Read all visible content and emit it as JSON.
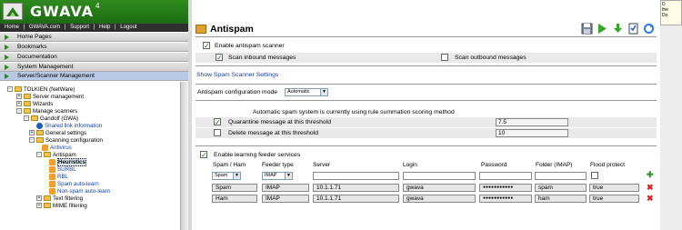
{
  "app": {
    "brand": "GWAVA",
    "version": "4"
  },
  "topbar": {
    "links": [
      "Home",
      "|",
      "GWAVA.com",
      "|",
      "Support",
      "|",
      "Help",
      "|",
      "Logout"
    ]
  },
  "nav": [
    "Home Pages",
    "Bookmarks",
    "Documentation",
    "System Management",
    "Server/Scanner Management"
  ],
  "tree": {
    "server": "TOLKIEN (NetWare)",
    "server_mgmt": "Server management",
    "wizards": "Wizards",
    "manage_scanners": "Manage scanners",
    "scanner": "Gandolf (GWA)",
    "shared_link": "Shared link information",
    "general_settings": "General settings",
    "scanning_config": "Scanning configuration",
    "antivirus": "Antivirus",
    "antispam": "Antispam",
    "heuristics": "Heuristics",
    "surbl": "SURBL",
    "rbl": "RBL",
    "spam_auto_learn": "Spam auto-learn",
    "nonspam_auto_learn": "Non-spam auto-learn",
    "text_filtering": "Text filtering",
    "mime_filtering": "MIME filtering"
  },
  "main": {
    "title": "Antispam",
    "enable_scanner": "Enable antispam scanner",
    "scan_inbound": "Scan inbound messages",
    "scan_outbound": "Scan outbound messages",
    "show_settings": "Show Spam Scanner Settings",
    "config_mode_label": "Antispam configuration mode",
    "config_mode_value": "Automatic",
    "auto_info": "Automatic spam system is currently using rule summation scoring method",
    "quarantine_label": "Quarantine message at this threshold",
    "quarantine_value": "7.5",
    "delete_label": "Delete message at this threshold",
    "delete_value": "10",
    "learning_label": "Enable learning feeder services"
  },
  "feeder": {
    "headers": [
      "Spam / Ham",
      "Feeder type",
      "Server",
      "Login",
      "Password",
      "Folder (IMAP)",
      "Flood protect"
    ],
    "new_row": {
      "type": "Spam",
      "feeder": "IMAP"
    },
    "rows": [
      {
        "type": "Spam",
        "feeder": "IMAP",
        "server": "10.1.1.71",
        "login": "gwava",
        "password": "●●●●●●●●●●●",
        "folder": "spam",
        "flood": "true"
      },
      {
        "type": "Ham",
        "feeder": "IMAP",
        "server": "10.1.1.71",
        "login": "gwava",
        "password": "●●●●●●●●●●●",
        "folder": "ham",
        "flood": "true"
      }
    ]
  },
  "note": {
    "lines": [
      "D",
      "the",
      "Do"
    ]
  }
}
